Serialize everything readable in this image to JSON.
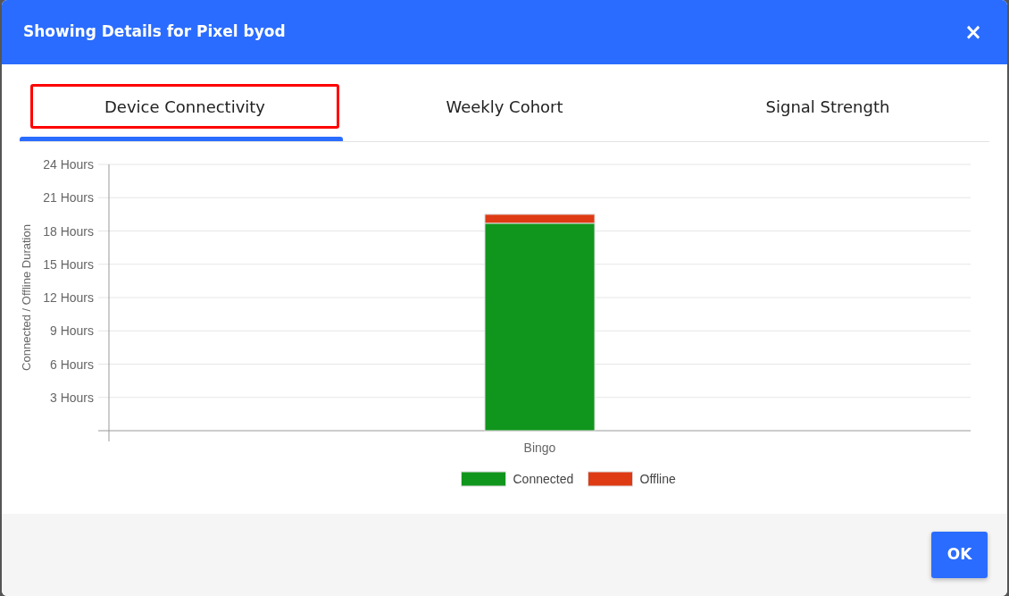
{
  "modal": {
    "title": "Showing Details for Pixel byod",
    "close": "×"
  },
  "tabs": [
    {
      "label": "Device Connectivity",
      "selected": true,
      "highlighted": true
    },
    {
      "label": "Weekly Cohort",
      "selected": false,
      "highlighted": false
    },
    {
      "label": "Signal Strength",
      "selected": false,
      "highlighted": false
    }
  ],
  "chart": {
    "chart_data": {
      "type": "bar",
      "stacked": true,
      "grid": true,
      "legend": "bottom",
      "ylabel": "Connected / Offline Duration",
      "categories": [
        "Bingo"
      ],
      "series": [
        {
          "name": "Connected",
          "color": "#11961d",
          "values": [
            18.7
          ]
        },
        {
          "name": "Offline",
          "color": "#de3b14",
          "values": [
            0.8
          ]
        }
      ],
      "ylim": [
        0,
        24
      ],
      "yticks": [
        {
          "value": 3,
          "label": "3 Hours"
        },
        {
          "value": 6,
          "label": "6 Hours"
        },
        {
          "value": 9,
          "label": "9 Hours"
        },
        {
          "value": 12,
          "label": "12 Hours"
        },
        {
          "value": 15,
          "label": "15 Hours"
        },
        {
          "value": 18,
          "label": "18 Hours"
        },
        {
          "value": 21,
          "label": "21 Hours"
        },
        {
          "value": 24,
          "label": "24 Hours"
        }
      ]
    }
  },
  "footer": {
    "ok": "OK"
  }
}
